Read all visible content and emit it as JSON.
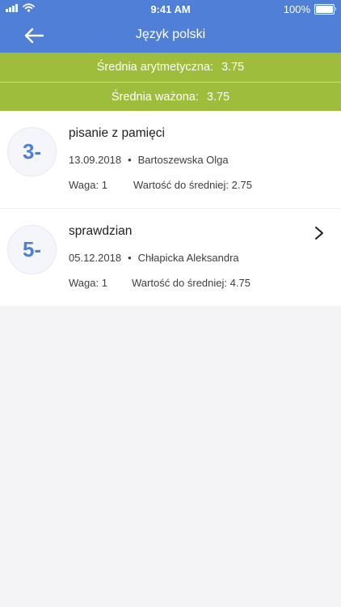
{
  "status_bar": {
    "time": "9:41 AM",
    "battery_text": "100%",
    "icons": [
      "signal-icon",
      "wifi-icon",
      "battery-icon"
    ]
  },
  "header": {
    "title": "Język polski",
    "back_icon": "arrow-left-icon",
    "color": "#4f7fd7"
  },
  "averages": {
    "arithmetic_label": "Średnia arytmetyczna:",
    "arithmetic_value": "3.75",
    "weighted_label": "Średnia ważona:",
    "weighted_value": "3.75",
    "color": "#9fbd3c"
  },
  "grades": [
    {
      "grade": "3-",
      "title": "pisanie z pamięci",
      "date": "13.09.2018",
      "separator": "•",
      "teacher": "Bartoszewska Olga",
      "weight": "Waga: 1",
      "contribution": "Wartość do średniej: 2.75"
    },
    {
      "grade": "5-",
      "title": "sprawdzian",
      "date": "05.12.2018",
      "separator": "•",
      "teacher": "Chłapicka Aleksandra",
      "weight": "Waga: 1",
      "contribution": "Wartość do średniej: 4.75",
      "chevron_icon": "chevron-right-icon"
    }
  ]
}
